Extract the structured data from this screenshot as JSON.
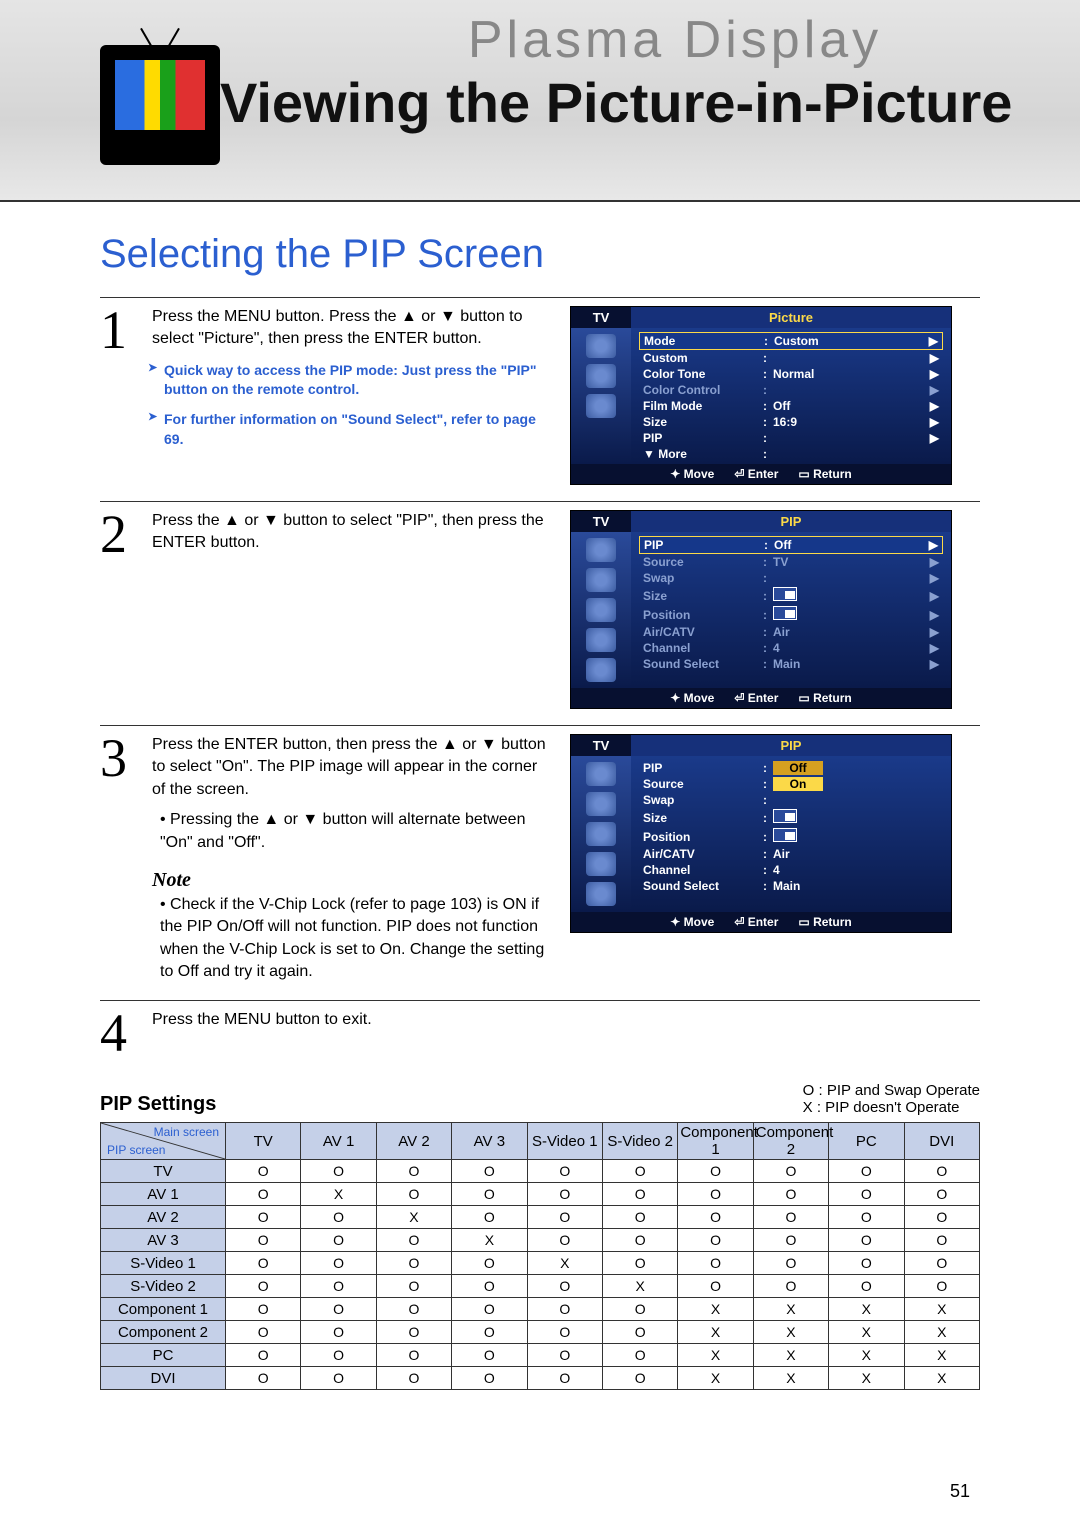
{
  "header": {
    "brand": "Plasma Display",
    "title": "Viewing the Picture-in-Picture"
  },
  "subtitle": "Selecting the PIP Screen",
  "steps": [
    {
      "num": "1",
      "text": "Press the MENU button. Press the ▲ or ▼ button to select \"Picture\", then press the ENTER button.",
      "bullets": [
        "Quick way to access the PIP mode: Just press the \"PIP\" button on the remote control.",
        "For further information on \"Sound Select\", refer to page 69."
      ]
    },
    {
      "num": "2",
      "text": "Press the ▲ or ▼ button to select \"PIP\", then press the ENTER button."
    },
    {
      "num": "3",
      "text": "Press the ENTER button, then press the ▲ or ▼ button to select \"On\". The PIP image will appear in the corner of the screen.",
      "extra": "• Pressing the ▲ or ▼ button will alternate between \"On\" and \"Off\".",
      "note_head": "Note",
      "note": "• Check if the V-Chip Lock (refer to page 103) is ON if the PIP On/Off will not function. PIP does not function when the V-Chip Lock is set to On. Change the setting to Off and try it again."
    },
    {
      "num": "4",
      "text": "Press the MENU button to exit."
    }
  ],
  "osd": {
    "tv_label": "TV",
    "picture_label": "Picture",
    "pip_label": "PIP",
    "footer": {
      "move": "Move",
      "enter": "Enter",
      "return": "Return"
    },
    "menu1": [
      {
        "k": "Mode",
        "v": "Custom",
        "hl": true,
        "arr": true
      },
      {
        "k": "Custom",
        "v": "",
        "arr": true
      },
      {
        "k": "Color Tone",
        "v": "Normal",
        "arr": true
      },
      {
        "k": "Color Control",
        "v": "",
        "dim": true,
        "arr": true
      },
      {
        "k": "Film Mode",
        "v": "Off",
        "arr": true
      },
      {
        "k": "Size",
        "v": "16:9",
        "arr": true
      },
      {
        "k": "PIP",
        "v": "",
        "arr": true
      },
      {
        "k": "▼ More",
        "v": ""
      }
    ],
    "menu2": [
      {
        "k": "PIP",
        "v": "Off",
        "hl": true,
        "arr": true
      },
      {
        "k": "Source",
        "v": "TV",
        "dim": true,
        "arr": true
      },
      {
        "k": "Swap",
        "v": "",
        "dim": true,
        "arr": true
      },
      {
        "k": "Size",
        "v": "",
        "dim": true,
        "icon": true,
        "arr": true
      },
      {
        "k": "Position",
        "v": "",
        "dim": true,
        "icon": true,
        "arr": true
      },
      {
        "k": "Air/CATV",
        "v": "Air",
        "dim": true,
        "arr": true
      },
      {
        "k": "Channel",
        "v": "4",
        "dim": true,
        "arr": true
      },
      {
        "k": "Sound Select",
        "v": "Main",
        "dim": true,
        "arr": true
      }
    ],
    "menu3_off": "Off",
    "menu3_on": "On",
    "menu3": [
      {
        "k": "PIP",
        "v": "",
        "box": "Off"
      },
      {
        "k": "Source",
        "v": "",
        "box": "On",
        "hlbox": true
      },
      {
        "k": "Swap",
        "v": ""
      },
      {
        "k": "Size",
        "v": "",
        "icon": true
      },
      {
        "k": "Position",
        "v": "",
        "icon": true
      },
      {
        "k": "Air/CATV",
        "v": "Air"
      },
      {
        "k": "Channel",
        "v": "4"
      },
      {
        "k": "Sound Select",
        "v": "Main"
      }
    ]
  },
  "settings": {
    "title": "PIP Settings",
    "legend_o": "O : PIP and Swap Operate",
    "legend_x": "X : PIP doesn't Operate",
    "corner_a": "Main screen",
    "corner_b": "PIP screen",
    "cols": [
      "TV",
      "AV 1",
      "AV 2",
      "AV 3",
      "S-Video 1",
      "S-Video 2",
      "Component 1",
      "Component 2",
      "PC",
      "DVI"
    ],
    "rows": [
      "TV",
      "AV 1",
      "AV 2",
      "AV 3",
      "S-Video 1",
      "S-Video 2",
      "Component 1",
      "Component 2",
      "PC",
      "DVI"
    ]
  },
  "chart_data": {
    "type": "table",
    "title": "PIP Settings operation matrix",
    "legend": {
      "O": "PIP and Swap Operate",
      "X": "PIP doesn't Operate"
    },
    "columns": [
      "TV",
      "AV 1",
      "AV 2",
      "AV 3",
      "S-Video 1",
      "S-Video 2",
      "Component 1",
      "Component 2",
      "PC",
      "DVI"
    ],
    "rows": [
      "TV",
      "AV 1",
      "AV 2",
      "AV 3",
      "S-Video 1",
      "S-Video 2",
      "Component 1",
      "Component 2",
      "PC",
      "DVI"
    ],
    "data": [
      [
        "O",
        "O",
        "O",
        "O",
        "O",
        "O",
        "O",
        "O",
        "O",
        "O"
      ],
      [
        "O",
        "X",
        "O",
        "O",
        "O",
        "O",
        "O",
        "O",
        "O",
        "O"
      ],
      [
        "O",
        "O",
        "X",
        "O",
        "O",
        "O",
        "O",
        "O",
        "O",
        "O"
      ],
      [
        "O",
        "O",
        "O",
        "X",
        "O",
        "O",
        "O",
        "O",
        "O",
        "O"
      ],
      [
        "O",
        "O",
        "O",
        "O",
        "X",
        "O",
        "O",
        "O",
        "O",
        "O"
      ],
      [
        "O",
        "O",
        "O",
        "O",
        "O",
        "X",
        "O",
        "O",
        "O",
        "O"
      ],
      [
        "O",
        "O",
        "O",
        "O",
        "O",
        "O",
        "X",
        "X",
        "X",
        "X"
      ],
      [
        "O",
        "O",
        "O",
        "O",
        "O",
        "O",
        "X",
        "X",
        "X",
        "X"
      ],
      [
        "O",
        "O",
        "O",
        "O",
        "O",
        "O",
        "X",
        "X",
        "X",
        "X"
      ],
      [
        "O",
        "O",
        "O",
        "O",
        "O",
        "O",
        "X",
        "X",
        "X",
        "X"
      ]
    ]
  },
  "pagenum": "51"
}
